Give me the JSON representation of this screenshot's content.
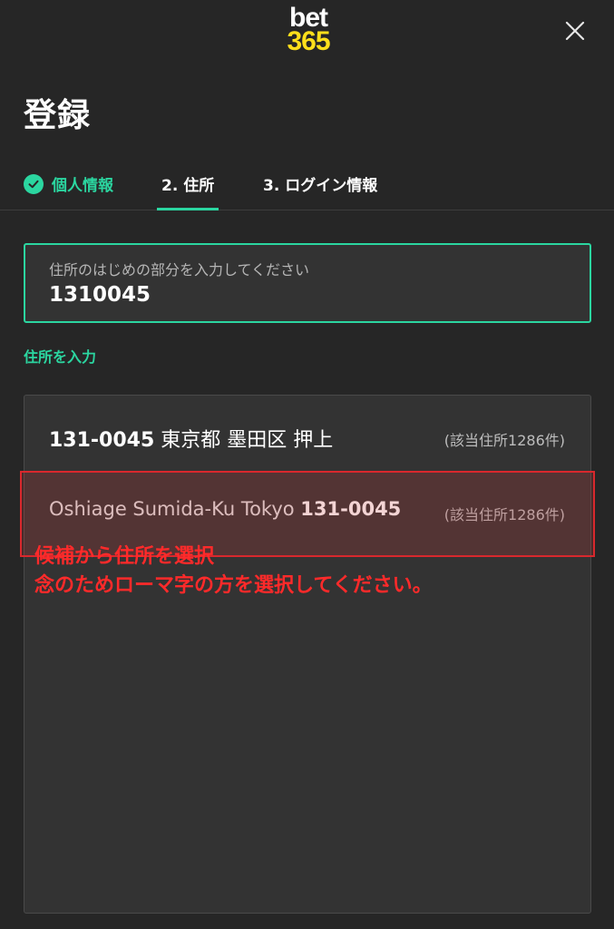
{
  "header": {
    "logo_line1": "bet",
    "logo_line2": "365",
    "title": "登録"
  },
  "steps": [
    {
      "label": "個人情報",
      "state": "done"
    },
    {
      "label": "2. 住所",
      "state": "active"
    },
    {
      "label": "3. ログイン情報",
      "state": "next"
    }
  ],
  "address_field": {
    "placeholder": "住所のはじめの部分を入力してください",
    "value": "1310045"
  },
  "manual_entry_link": "住所を入力",
  "suggestions": [
    {
      "prefix": "",
      "code": "131-0045",
      "suffix": " 東京都 墨田区 押上",
      "count": "(該当住所1286件)"
    },
    {
      "prefix": "Oshiage Sumida-Ku Tokyo ",
      "code": "131-0045",
      "suffix": "",
      "count": "(該当住所1286件)"
    }
  ],
  "annotation": {
    "line1": "候補から住所を選択",
    "line2": "念のためローマ字の方を選択してください。"
  },
  "colors": {
    "background": "#262626",
    "accent": "#2bd6a0",
    "logo_yellow": "#ffdf1b",
    "annotation_red": "#ff2a2a"
  }
}
